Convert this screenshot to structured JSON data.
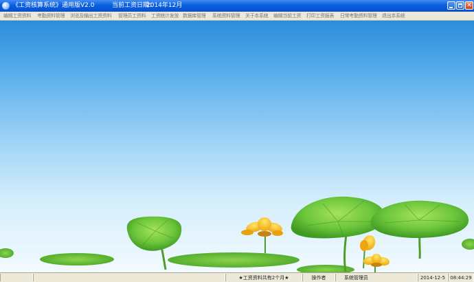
{
  "window": {
    "title": "《工资核算系统》通用版V2.0",
    "date_label": "当前工资日期：",
    "date_value": "2014年12月"
  },
  "menu": [
    "编辑工资资料",
    "考勤资料管理",
    "浏览及输出工资资料",
    "管理员工资料",
    "工资统计发放",
    "数据库管理",
    "系统资料管理",
    "关于本系统",
    "编辑当前工资",
    "打印工资报表",
    "日常考勤资料管理",
    "退出本系统"
  ],
  "status": {
    "message": "★工资资料共有2个月★",
    "operator_label": "操作者",
    "operator_value": "系统管理员",
    "date": "2014-12-5",
    "time": "08:44:29"
  },
  "colors": {
    "titlebar": "#0a5fe0",
    "menubar": "#ece9d8",
    "sky_top": "#2a8ddc",
    "sky_bottom": "#f2fafe",
    "lotus_leaf": "#6cc63c",
    "flower": "#f7c21c"
  },
  "icons": [
    "app-icon",
    "minimize-icon",
    "maximize-icon",
    "close-icon"
  ]
}
